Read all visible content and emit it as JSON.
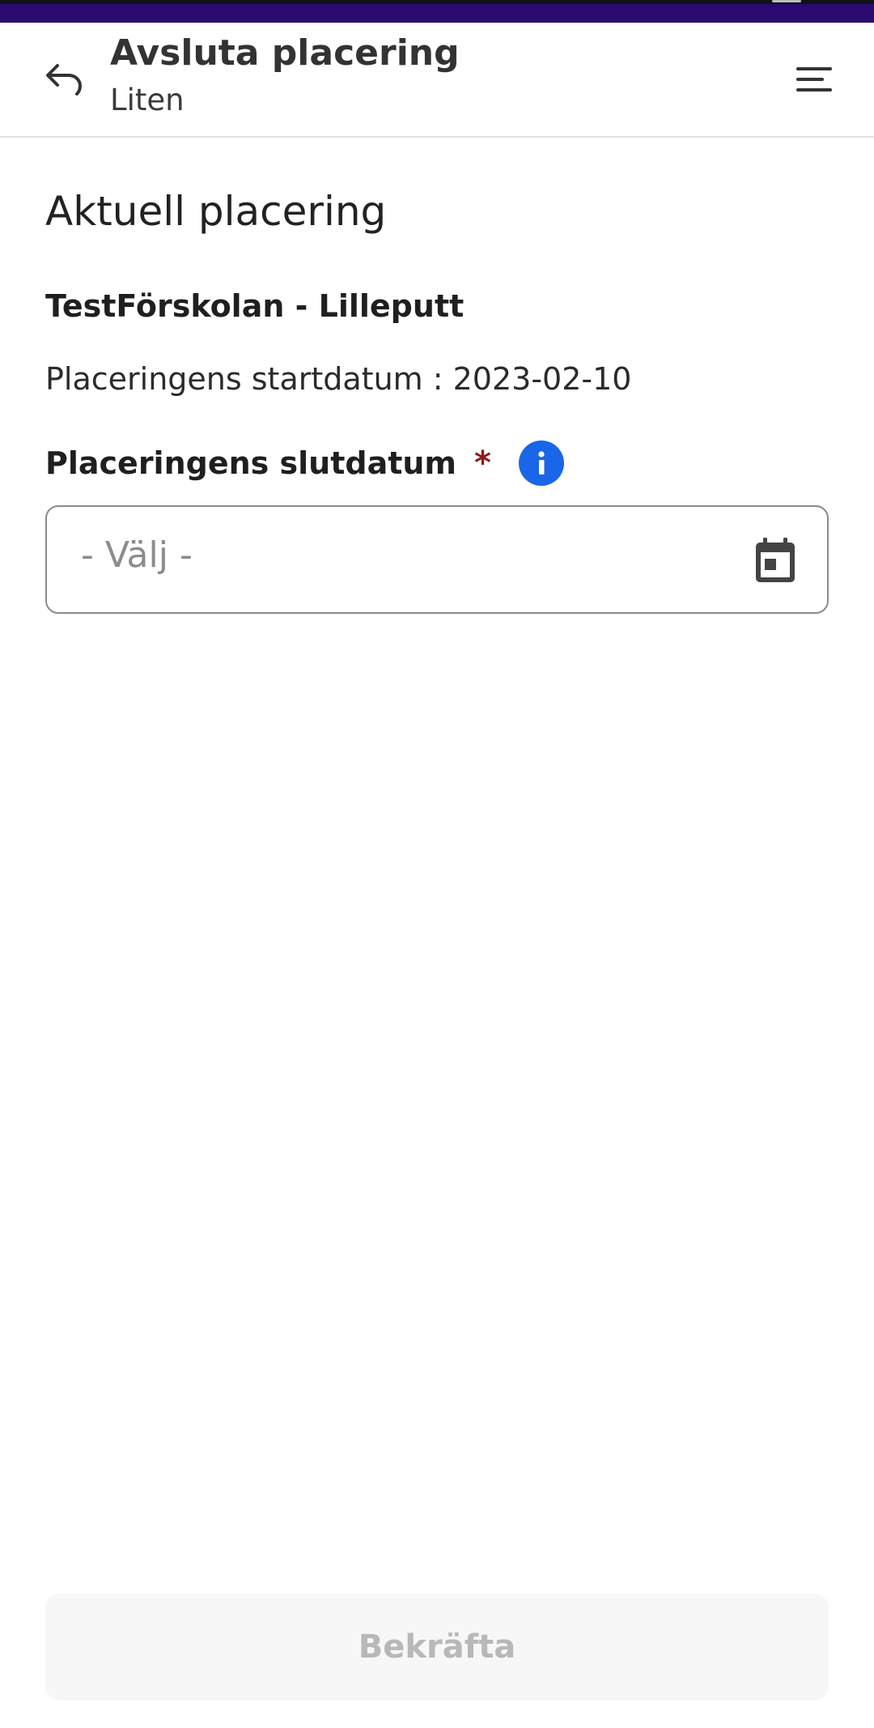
{
  "header": {
    "title": "Avsluta placering",
    "subtitle": "Liten",
    "back_icon": "back-arrow-icon",
    "menu_icon": "hamburger-menu-icon"
  },
  "main": {
    "section_title": "Aktuell placering",
    "unit_name": "TestFörskolan - Lilleputt",
    "start_date_text": "Placeringens startdatum : 2023-02-10",
    "end_date_label": "Placeringens slutdatum",
    "required_marker": "*",
    "info_icon": "info-icon",
    "end_date_field": {
      "value": "",
      "placeholder": "- Välj -",
      "icon": "calendar-icon"
    }
  },
  "footer": {
    "confirm_label": "Bekräfta",
    "confirm_enabled": false
  },
  "colors": {
    "status_bar": "#2a0a70",
    "info_blue": "#1a66e8",
    "required_red": "#8b1c1c",
    "disabled_text": "#b8b8b8"
  }
}
